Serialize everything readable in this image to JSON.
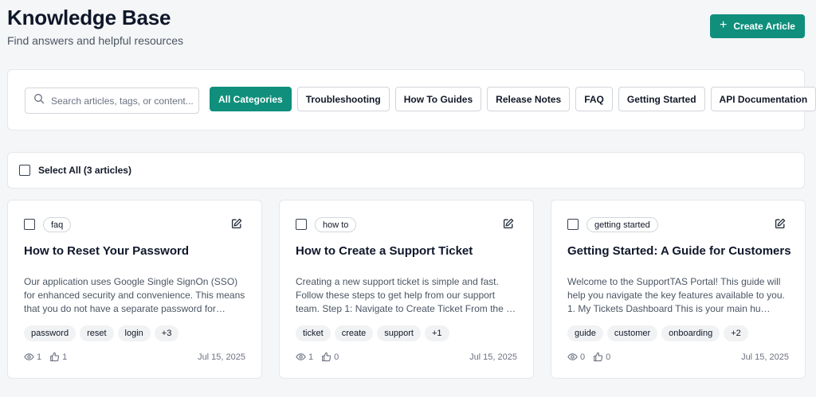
{
  "header": {
    "title": "Knowledge Base",
    "subtitle": "Find answers and helpful resources",
    "create_label": "Create Article",
    "create_icon": "plus-icon"
  },
  "search": {
    "placeholder": "Search articles, tags, or content...",
    "value": "",
    "icon": "search-icon"
  },
  "categories": [
    {
      "label": "All Categories",
      "active": true
    },
    {
      "label": "Troubleshooting",
      "active": false
    },
    {
      "label": "How To Guides",
      "active": false
    },
    {
      "label": "Release Notes",
      "active": false
    },
    {
      "label": "FAQ",
      "active": false
    },
    {
      "label": "Getting Started",
      "active": false
    },
    {
      "label": "API Documentation",
      "active": false
    }
  ],
  "selection": {
    "label": "Select All (3 articles)",
    "checked": false
  },
  "articles": [
    {
      "category": "faq",
      "title": "How to Reset Your Password",
      "excerpt": "Our application uses Google Single SignOn (SSO) for enhanced security and convenience. This means that you do not have a separate password for…",
      "tags": [
        "password",
        "reset",
        "login",
        "+3"
      ],
      "views": "1",
      "likes": "1",
      "date": "Jul 15, 2025"
    },
    {
      "category": "how to",
      "title": "How to Create a Support Ticket",
      "excerpt": "Creating a new support ticket is simple and fast. Follow these steps to get help from our support team. Step 1: Navigate to Create Ticket From the …",
      "tags": [
        "ticket",
        "create",
        "support",
        "+1"
      ],
      "views": "1",
      "likes": "0",
      "date": "Jul 15, 2025"
    },
    {
      "category": "getting started",
      "title": "Getting Started: A Guide for Customers",
      "excerpt": "Welcome to the SupportTAS Portal! This guide will help you navigate the key features available to you. 1. My Tickets Dashboard This is your main hu…",
      "tags": [
        "guide",
        "customer",
        "onboarding",
        "+2"
      ],
      "views": "0",
      "likes": "0",
      "date": "Jul 15, 2025"
    }
  ],
  "colors": {
    "accent": "#0f8f7c",
    "background": "#f5f6f7"
  }
}
